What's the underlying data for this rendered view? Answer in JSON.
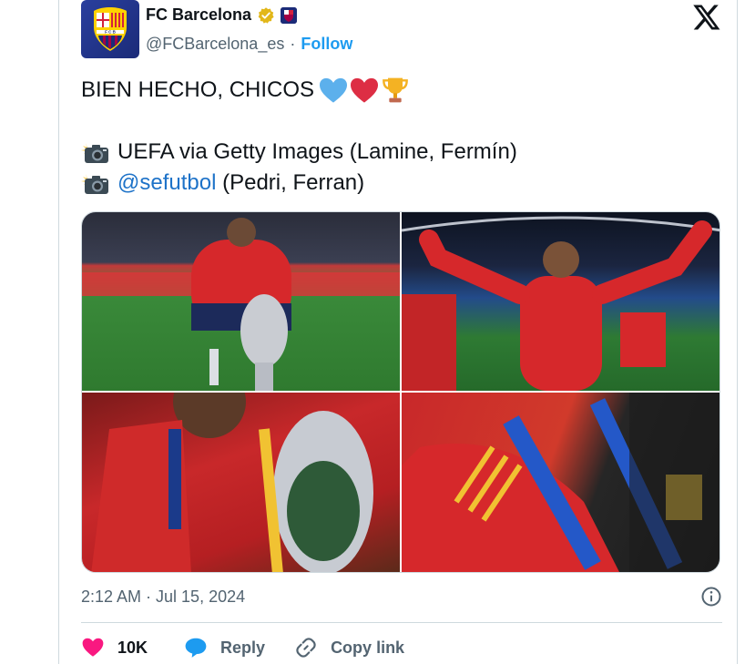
{
  "account": {
    "display_name": "FC Barcelona",
    "handle": "@FCBarcelona_es",
    "separator": "·",
    "follow_label": "Follow"
  },
  "tweet": {
    "line1": "BIEN HECHO, CHICOS",
    "credit1_text": "UEFA via Getty Images (Lamine, Fermín)",
    "credit2_mention": "@sefutbol",
    "credit2_text": " (Pedri, Ferran)"
  },
  "photos": [
    {
      "icon": "photo-trophy-kneeling"
    },
    {
      "icon": "photo-celebrating-player-11"
    },
    {
      "icon": "photo-kissing-trophy"
    },
    {
      "icon": "photo-uefa-euro-2024-medals"
    }
  ],
  "meta": {
    "timestamp": "2:12 AM · Jul 15, 2024"
  },
  "actions": {
    "like_count": "10K",
    "reply_label": "Reply",
    "copy_label": "Copy link"
  },
  "colors": {
    "accent": "#1d9bf0",
    "like": "#f91880",
    "reply": "#1d9bf0",
    "text_secondary": "#536471"
  }
}
